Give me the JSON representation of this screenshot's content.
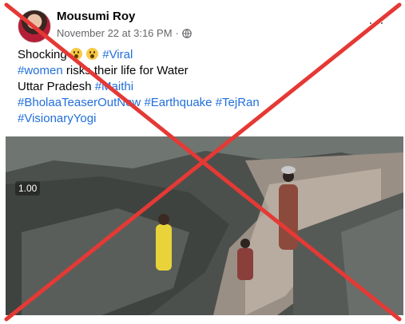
{
  "post": {
    "author": "Mousumi Roy",
    "timestamp": "November 22 at 3:16 PM",
    "separator": "·",
    "more_label": "···",
    "text": {
      "line1": {
        "word": "Shocking",
        "tag": "#Viral",
        "emoji_count": 2
      },
      "line2": {
        "tag": "#women",
        "text": " risks their life for Water"
      },
      "line3": {
        "text": "Uttar Pradesh ",
        "tag": "#Maithi"
      },
      "line4": {
        "tags": [
          "#BholaaTeaserOutNow",
          "#Earthquake",
          "#TejRan"
        ]
      },
      "line5": {
        "tag": "#VisionaryYogi"
      }
    },
    "video": {
      "speed_label": "1.00"
    }
  },
  "colors": {
    "hashtag": "#216fdb",
    "cross": "#e53935",
    "meta": "#65676b"
  },
  "icons": [
    "globe-icon",
    "more-options-icon",
    "surprised-emoji-icon"
  ]
}
